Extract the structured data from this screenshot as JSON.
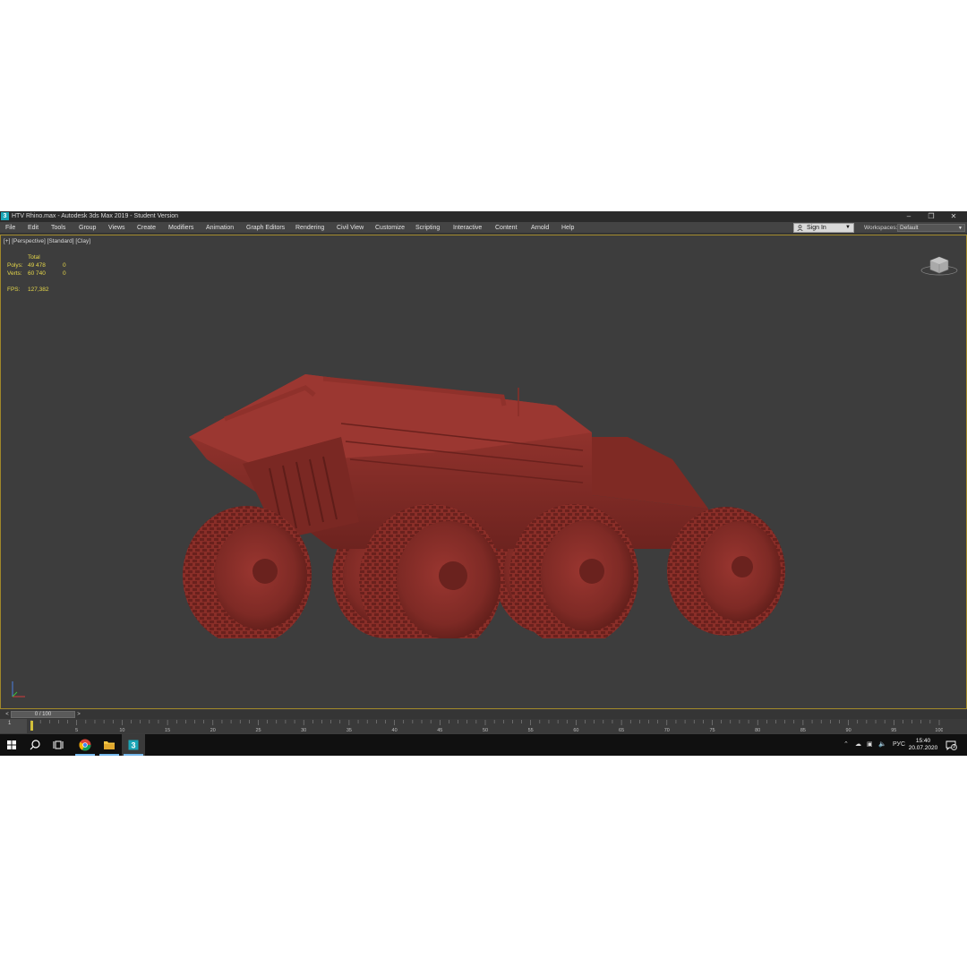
{
  "window": {
    "title": "HTV Rhino.max - Autodesk 3ds Max 2019 - Student Version",
    "app_logo": "3",
    "controls": [
      "minimize-icon",
      "restore-icon",
      "close-icon"
    ]
  },
  "menu": {
    "items": [
      "File",
      "Edit",
      "Tools",
      "Group",
      "Views",
      "Create",
      "Modifiers",
      "Animation",
      "Graph Editors",
      "Rendering",
      "Civil View",
      "Customize",
      "Scripting",
      "Interactive",
      "Content",
      "Arnold",
      "Help"
    ],
    "sign_in": "Sign In",
    "workspaces_label": "Workspaces:",
    "workspace_value": "Default"
  },
  "viewport": {
    "label": "[+] [Perspective] [Standard] [Clay]",
    "stats": {
      "header": "Total",
      "polys_label": "Polys:",
      "polys_total": "49 478",
      "polys_sel": "0",
      "verts_label": "Verts:",
      "verts_total": "60 740",
      "verts_sel": "0",
      "fps_label": "FPS:",
      "fps_value": "127,382"
    },
    "model_color": "#8a2e28",
    "background_color": "#3d3d3d"
  },
  "timeline": {
    "left_arrow": "<",
    "frame_display": "0 / 100",
    "right_arrow": ">",
    "corner_label": "1",
    "ticks": [
      "5",
      "10",
      "15",
      "20",
      "25",
      "30",
      "35",
      "40",
      "45",
      "50",
      "55",
      "60",
      "65",
      "70",
      "75",
      "80",
      "85",
      "90",
      "95",
      "100"
    ]
  },
  "taskbar": {
    "apps": [
      "windows-start-icon",
      "search-icon",
      "task-view-icon",
      "chrome-icon",
      "file-explorer-icon",
      "3ds-max-icon"
    ],
    "language": "РУС",
    "time": "15:40",
    "date": "20.07.2020",
    "notification_count": "3"
  }
}
